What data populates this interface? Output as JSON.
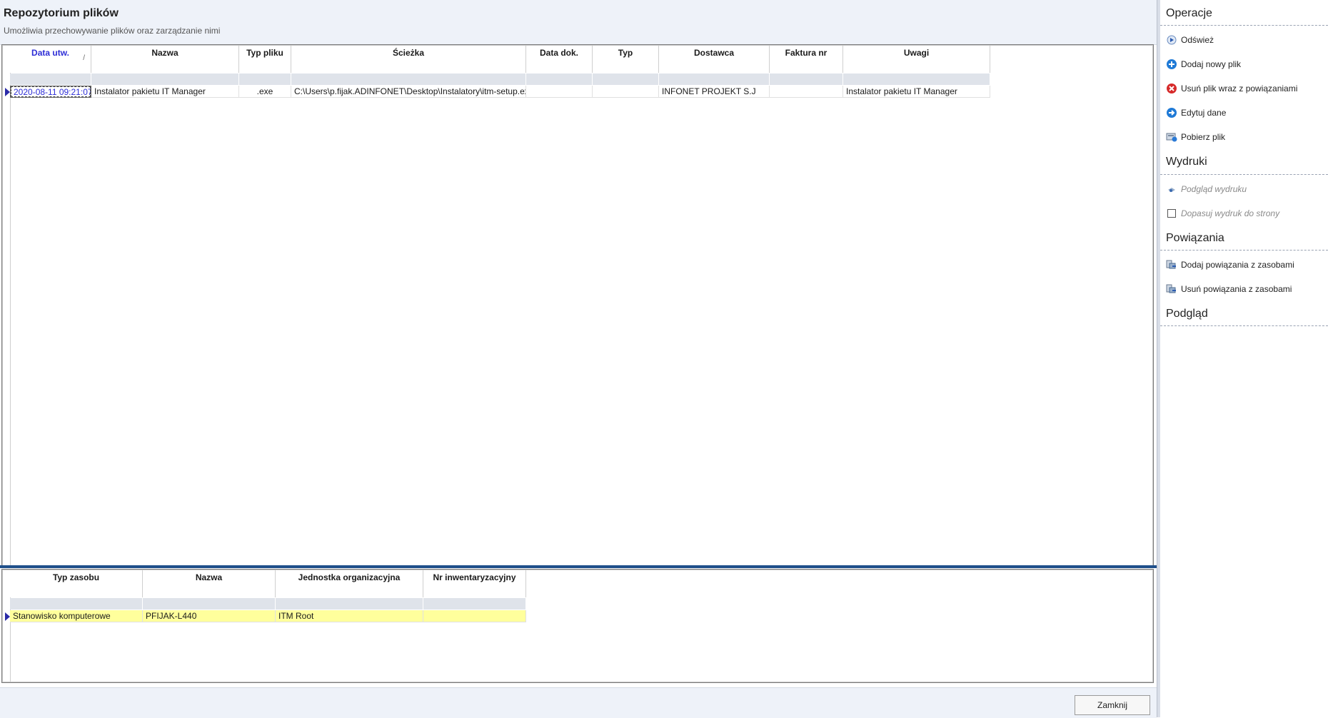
{
  "header": {
    "title": "Repozytorium plików",
    "subtitle": "Umożliwia przechowywanie plików oraz zarządzanie nimi"
  },
  "main_grid": {
    "columns": [
      {
        "label": "Data utw.",
        "sorted": true,
        "sort_glyph": "/"
      },
      {
        "label": "Nazwa"
      },
      {
        "label": "Typ pliku"
      },
      {
        "label": "Ścieżka"
      },
      {
        "label": "Data dok."
      },
      {
        "label": "Typ"
      },
      {
        "label": "Dostawca"
      },
      {
        "label": "Faktura nr"
      },
      {
        "label": "Uwagi"
      }
    ],
    "rows": [
      {
        "data_utw": "2020-08-11 09:21:07",
        "nazwa": "Instalator pakietu IT Manager",
        "typ_pliku": ".exe",
        "sciezka": "C:\\Users\\p.fijak.ADINFONET\\Desktop\\Instalatory\\itm-setup.exe",
        "data_dok": "",
        "typ": "",
        "dostawca": "INFONET PROJEKT S.J",
        "faktura_nr": "",
        "uwagi": "Instalator pakietu IT Manager"
      }
    ]
  },
  "sub_grid": {
    "columns": [
      {
        "label": "Typ zasobu"
      },
      {
        "label": "Nazwa"
      },
      {
        "label": "Jednostka organizacyjna"
      },
      {
        "label": "Nr inwentaryzacyjny"
      }
    ],
    "rows": [
      {
        "typ_zasobu": "Stanowisko komputerowe",
        "nazwa": "PFIJAK-L440",
        "jednostka": "ITM Root",
        "nr_inw": ""
      }
    ]
  },
  "footer": {
    "close_label": "Zamknij"
  },
  "sidepanel": {
    "operacje": {
      "title": "Operacje",
      "items": [
        {
          "label": "Odśwież",
          "icon": "refresh-icon"
        },
        {
          "label": "Dodaj nowy plik",
          "icon": "add-icon"
        },
        {
          "label": "Usuń plik wraz z powiązaniami",
          "icon": "delete-icon"
        },
        {
          "label": "Edytuj dane",
          "icon": "edit-icon"
        },
        {
          "label": "Pobierz plik",
          "icon": "download-icon"
        }
      ]
    },
    "wydruki": {
      "title": "Wydruki",
      "items": [
        {
          "label": "Podgląd wydruku",
          "icon": "print-preview-icon"
        },
        {
          "label": "Dopasuj wydruk do strony",
          "icon": "checkbox-icon"
        }
      ]
    },
    "powiazania": {
      "title": "Powiązania",
      "items": [
        {
          "label": "Dodaj powiązania z zasobami",
          "icon": "link-add-icon"
        },
        {
          "label": "Usuń powiązania z zasobami",
          "icon": "link-remove-icon"
        }
      ]
    },
    "podglad": {
      "title": "Podgląd"
    }
  },
  "colors": {
    "accent": "#2d2dd6",
    "header_bg": "#eef2f9",
    "splitter": "#1f4f8a",
    "selected_row": "#ffff9c",
    "add_icon": "#1f7ad6",
    "delete_icon": "#d62a2a"
  }
}
